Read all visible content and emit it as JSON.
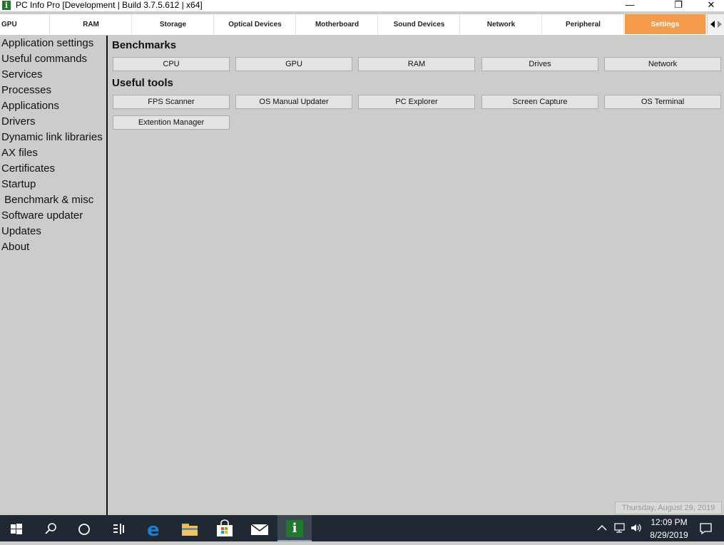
{
  "window": {
    "title": "PC Info Pro [Development | Build 3.7.5.612 | x64]",
    "app_icon_glyph": "i",
    "minimize_glyph": "—",
    "maximize_glyph": "❐",
    "close_glyph": "✕"
  },
  "tabs": [
    {
      "label": "GPU"
    },
    {
      "label": "RAM"
    },
    {
      "label": "Storage"
    },
    {
      "label": "Optical Devices"
    },
    {
      "label": "Motherboard"
    },
    {
      "label": "Sound Devices"
    },
    {
      "label": "Network"
    },
    {
      "label": "Peripheral"
    },
    {
      "label": "Settings",
      "active": true
    }
  ],
  "sidebar": {
    "items": [
      {
        "label": "Application settings"
      },
      {
        "label": "Useful commands"
      },
      {
        "label": "Services"
      },
      {
        "label": "Processes"
      },
      {
        "label": "Applications"
      },
      {
        "label": "Drivers"
      },
      {
        "label": "Dynamic link libraries"
      },
      {
        "label": "AX files"
      },
      {
        "label": "Certificates"
      },
      {
        "label": "Startup"
      },
      {
        "label": " Benchmark & misc"
      },
      {
        "label": "Software updater"
      },
      {
        "label": "Updates"
      },
      {
        "label": "About"
      }
    ]
  },
  "benchmarks": {
    "title": "Benchmarks",
    "buttons": [
      {
        "label": "CPU"
      },
      {
        "label": "GPU"
      },
      {
        "label": "RAM"
      },
      {
        "label": "Drives"
      },
      {
        "label": "Network"
      }
    ]
  },
  "tools": {
    "title": "Useful tools",
    "buttons": [
      {
        "label": "FPS Scanner"
      },
      {
        "label": "OS Manual Updater"
      },
      {
        "label": "PC Explorer"
      },
      {
        "label": "Screen Capture"
      },
      {
        "label": "OS Terminal"
      },
      {
        "label": "Extention Manager"
      }
    ]
  },
  "status": {
    "date_text": "Thursday, August 29, 2019"
  },
  "taskbar": {
    "time": "12:09 PM",
    "date": "8/29/2019",
    "pinned_app_glyph": "i"
  },
  "colors": {
    "accent_tab": "#f59b4c",
    "background": "#cbcdca",
    "taskbar": "#1f2833"
  }
}
